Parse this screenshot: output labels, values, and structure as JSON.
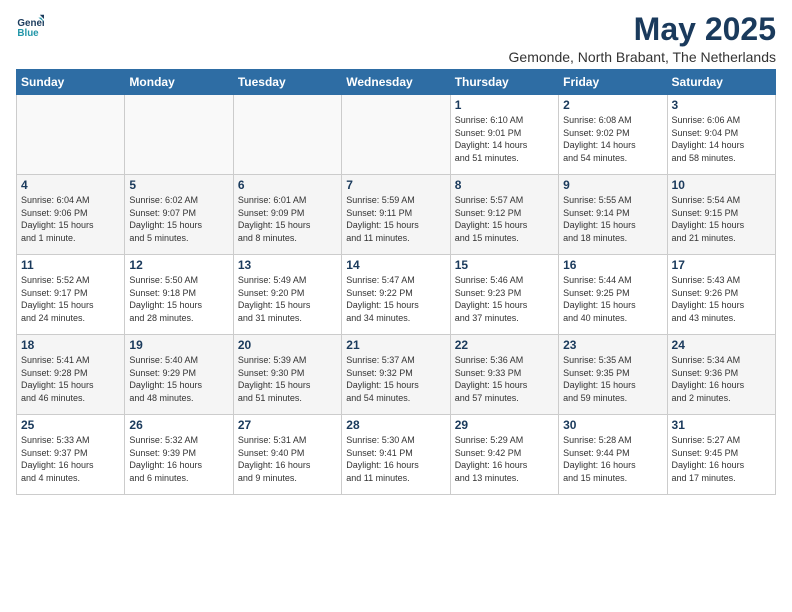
{
  "logo": {
    "line1": "General",
    "line2": "Blue"
  },
  "title": "May 2025",
  "subtitle": "Gemonde, North Brabant, The Netherlands",
  "days_header": [
    "Sunday",
    "Monday",
    "Tuesday",
    "Wednesday",
    "Thursday",
    "Friday",
    "Saturday"
  ],
  "weeks": [
    [
      {
        "day": "",
        "info": ""
      },
      {
        "day": "",
        "info": ""
      },
      {
        "day": "",
        "info": ""
      },
      {
        "day": "",
        "info": ""
      },
      {
        "day": "1",
        "info": "Sunrise: 6:10 AM\nSunset: 9:01 PM\nDaylight: 14 hours\nand 51 minutes."
      },
      {
        "day": "2",
        "info": "Sunrise: 6:08 AM\nSunset: 9:02 PM\nDaylight: 14 hours\nand 54 minutes."
      },
      {
        "day": "3",
        "info": "Sunrise: 6:06 AM\nSunset: 9:04 PM\nDaylight: 14 hours\nand 58 minutes."
      }
    ],
    [
      {
        "day": "4",
        "info": "Sunrise: 6:04 AM\nSunset: 9:06 PM\nDaylight: 15 hours\nand 1 minute."
      },
      {
        "day": "5",
        "info": "Sunrise: 6:02 AM\nSunset: 9:07 PM\nDaylight: 15 hours\nand 5 minutes."
      },
      {
        "day": "6",
        "info": "Sunrise: 6:01 AM\nSunset: 9:09 PM\nDaylight: 15 hours\nand 8 minutes."
      },
      {
        "day": "7",
        "info": "Sunrise: 5:59 AM\nSunset: 9:11 PM\nDaylight: 15 hours\nand 11 minutes."
      },
      {
        "day": "8",
        "info": "Sunrise: 5:57 AM\nSunset: 9:12 PM\nDaylight: 15 hours\nand 15 minutes."
      },
      {
        "day": "9",
        "info": "Sunrise: 5:55 AM\nSunset: 9:14 PM\nDaylight: 15 hours\nand 18 minutes."
      },
      {
        "day": "10",
        "info": "Sunrise: 5:54 AM\nSunset: 9:15 PM\nDaylight: 15 hours\nand 21 minutes."
      }
    ],
    [
      {
        "day": "11",
        "info": "Sunrise: 5:52 AM\nSunset: 9:17 PM\nDaylight: 15 hours\nand 24 minutes."
      },
      {
        "day": "12",
        "info": "Sunrise: 5:50 AM\nSunset: 9:18 PM\nDaylight: 15 hours\nand 28 minutes."
      },
      {
        "day": "13",
        "info": "Sunrise: 5:49 AM\nSunset: 9:20 PM\nDaylight: 15 hours\nand 31 minutes."
      },
      {
        "day": "14",
        "info": "Sunrise: 5:47 AM\nSunset: 9:22 PM\nDaylight: 15 hours\nand 34 minutes."
      },
      {
        "day": "15",
        "info": "Sunrise: 5:46 AM\nSunset: 9:23 PM\nDaylight: 15 hours\nand 37 minutes."
      },
      {
        "day": "16",
        "info": "Sunrise: 5:44 AM\nSunset: 9:25 PM\nDaylight: 15 hours\nand 40 minutes."
      },
      {
        "day": "17",
        "info": "Sunrise: 5:43 AM\nSunset: 9:26 PM\nDaylight: 15 hours\nand 43 minutes."
      }
    ],
    [
      {
        "day": "18",
        "info": "Sunrise: 5:41 AM\nSunset: 9:28 PM\nDaylight: 15 hours\nand 46 minutes."
      },
      {
        "day": "19",
        "info": "Sunrise: 5:40 AM\nSunset: 9:29 PM\nDaylight: 15 hours\nand 48 minutes."
      },
      {
        "day": "20",
        "info": "Sunrise: 5:39 AM\nSunset: 9:30 PM\nDaylight: 15 hours\nand 51 minutes."
      },
      {
        "day": "21",
        "info": "Sunrise: 5:37 AM\nSunset: 9:32 PM\nDaylight: 15 hours\nand 54 minutes."
      },
      {
        "day": "22",
        "info": "Sunrise: 5:36 AM\nSunset: 9:33 PM\nDaylight: 15 hours\nand 57 minutes."
      },
      {
        "day": "23",
        "info": "Sunrise: 5:35 AM\nSunset: 9:35 PM\nDaylight: 15 hours\nand 59 minutes."
      },
      {
        "day": "24",
        "info": "Sunrise: 5:34 AM\nSunset: 9:36 PM\nDaylight: 16 hours\nand 2 minutes."
      }
    ],
    [
      {
        "day": "25",
        "info": "Sunrise: 5:33 AM\nSunset: 9:37 PM\nDaylight: 16 hours\nand 4 minutes."
      },
      {
        "day": "26",
        "info": "Sunrise: 5:32 AM\nSunset: 9:39 PM\nDaylight: 16 hours\nand 6 minutes."
      },
      {
        "day": "27",
        "info": "Sunrise: 5:31 AM\nSunset: 9:40 PM\nDaylight: 16 hours\nand 9 minutes."
      },
      {
        "day": "28",
        "info": "Sunrise: 5:30 AM\nSunset: 9:41 PM\nDaylight: 16 hours\nand 11 minutes."
      },
      {
        "day": "29",
        "info": "Sunrise: 5:29 AM\nSunset: 9:42 PM\nDaylight: 16 hours\nand 13 minutes."
      },
      {
        "day": "30",
        "info": "Sunrise: 5:28 AM\nSunset: 9:44 PM\nDaylight: 16 hours\nand 15 minutes."
      },
      {
        "day": "31",
        "info": "Sunrise: 5:27 AM\nSunset: 9:45 PM\nDaylight: 16 hours\nand 17 minutes."
      }
    ]
  ]
}
